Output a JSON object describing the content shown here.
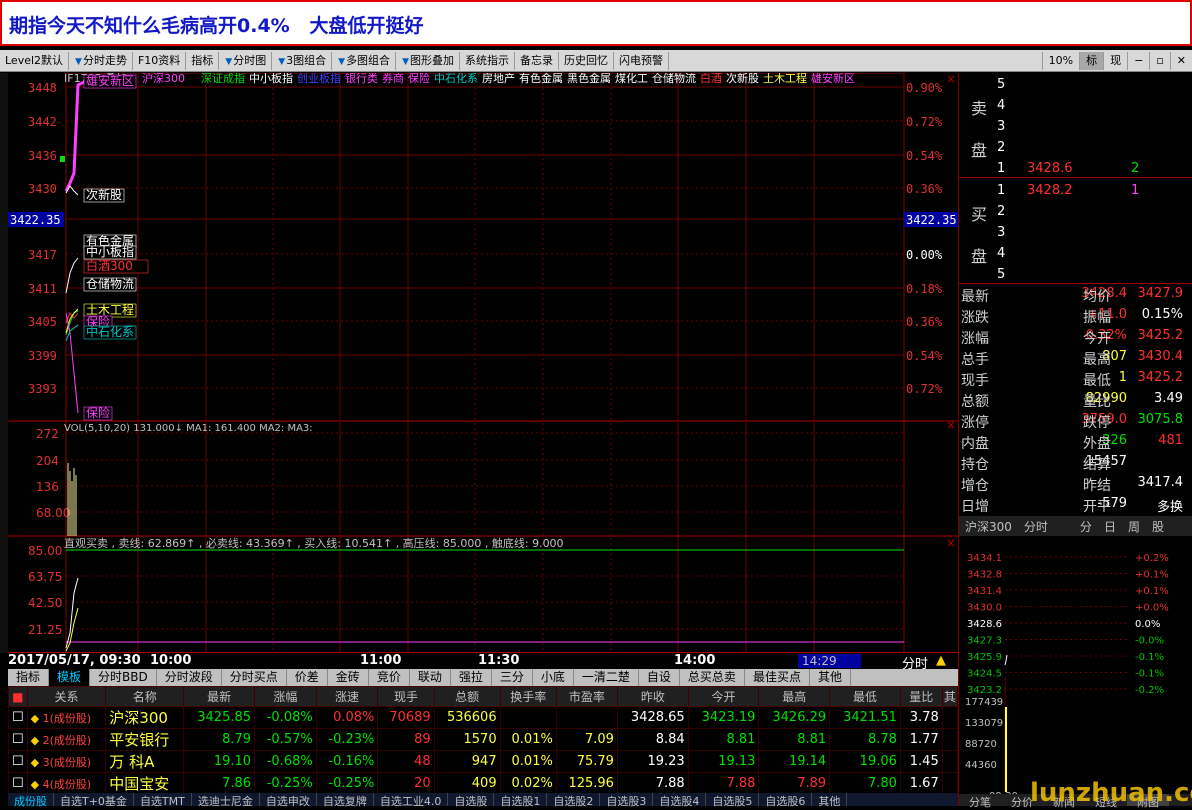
{
  "banner": {
    "text": "期指今天不知什么毛病高开0.4%   大盘低开挺好"
  },
  "toolbar": {
    "items": [
      "Level2默认",
      "分时走势",
      "F10资料",
      "指标",
      "分时图",
      "3图组合",
      "多图组合",
      "图形叠加",
      "系统指示",
      "备忘录",
      "历史回忆",
      "闪电预警"
    ],
    "right": [
      "10%",
      "标",
      "现"
    ]
  },
  "chart": {
    "code": "IF1705 叠加",
    "overlays": [
      "沪深300",
      "深证成指",
      "中小板指",
      "创业板指",
      "银行类",
      "券商",
      "保险",
      "中石化系",
      "房地产",
      "有色金属",
      "黑色金属",
      "煤化工",
      "仓储物流",
      "白酒",
      "次新股",
      "土木工程",
      "雄安新区"
    ],
    "overlay_colors": [
      "#ff40ff",
      "#00e000",
      "#ffffff",
      "#4040ff",
      "#ff40ff",
      "#ff40ff",
      "#ff40ff",
      "#00c8c8",
      "#ffffff",
      "#ffffff",
      "#ffffff",
      "#ffffff",
      "#ffffff",
      "#ff3030",
      "#ffffff",
      "#ffff40",
      "#ff40ff"
    ],
    "price_ticks": [
      "3448",
      "3442",
      "3436",
      "3430",
      "3422.35",
      "3417",
      "3411",
      "3405",
      "3399",
      "3393"
    ],
    "pct_ticks": [
      "0.90%",
      "0.72%",
      "0.54%",
      "0.36%",
      "3422.35",
      "0.00%",
      "0.18%",
      "0.36%",
      "0.54%",
      "0.72%"
    ],
    "inline_labels": [
      "雄安新区",
      "次新股",
      "有色金属",
      "中小板指",
      "白酒300",
      "仓储物流",
      "土木工程",
      "保险",
      "中石化系",
      "保险"
    ],
    "vol_header": [
      "VOL(5,10,20)",
      "131.000↓",
      "MA1: 161.400",
      "MA2:",
      "MA3:"
    ],
    "vol_ticks": [
      "272",
      "204",
      "136",
      "68.00"
    ],
    "ind_header": [
      "直观买卖",
      "卖线: 62.869↑",
      "必卖线: 43.369↑",
      "买入线: 10.541↑",
      "高压线: 85.000",
      "触底线: 9.000"
    ],
    "ind_ticks": [
      "85.00",
      "63.75",
      "42.50",
      "21.25"
    ],
    "time_axis": [
      "2017/05/17, 09:30",
      "10:00",
      "11:00",
      "11:30",
      "14:00"
    ],
    "cursor_time": "14:29",
    "mode": "分时"
  },
  "side": {
    "sell_rows": [
      {
        "n": "5",
        "p": "",
        "q": ""
      },
      {
        "n": "4",
        "p": "",
        "q": ""
      },
      {
        "n": "3",
        "p": "",
        "q": ""
      },
      {
        "n": "2",
        "p": "",
        "q": ""
      },
      {
        "n": "1",
        "p": "3428.6",
        "q": "2"
      }
    ],
    "buy_rows": [
      {
        "n": "1",
        "p": "3428.2",
        "q": "1"
      },
      {
        "n": "2",
        "p": "",
        "q": ""
      },
      {
        "n": "3",
        "p": "",
        "q": ""
      },
      {
        "n": "4",
        "p": "",
        "q": ""
      },
      {
        "n": "5",
        "p": "",
        "q": ""
      }
    ],
    "sell_label": [
      "卖",
      "盘"
    ],
    "buy_label": [
      "买",
      "盘"
    ],
    "stats": [
      {
        "l": "最新",
        "v": "3428.4",
        "vc": "red",
        "l2": "均价",
        "v2": "3427.9",
        "v2c": "red"
      },
      {
        "l": "涨跌",
        "v": "+11.0",
        "vc": "red",
        "l2": "振幅",
        "v2": "0.15%",
        "v2c": "wht"
      },
      {
        "l": "涨幅",
        "v": "0.32%",
        "vc": "red",
        "l2": "今开",
        "v2": "3425.2",
        "v2c": "red"
      },
      {
        "l": "总手",
        "v": "807",
        "vc": "yel",
        "l2": "最高",
        "v2": "3430.4",
        "v2c": "red"
      },
      {
        "l": "现手",
        "v": "1",
        "vc": "yel",
        "l2": "最低",
        "v2": "3425.2",
        "v2c": "red"
      },
      {
        "l": "总额",
        "v": "82990",
        "vc": "yel",
        "l2": "量比",
        "v2": "3.49",
        "v2c": "wht"
      },
      {
        "l": "涨停",
        "v": "3759.0",
        "vc": "red",
        "l2": "跌停",
        "v2": "3075.8",
        "v2c": "grn"
      },
      {
        "l": "内盘",
        "v": "326",
        "vc": "grn",
        "l2": "外盘",
        "v2": "481",
        "v2c": "red"
      },
      {
        "l": "持仓",
        "v": "15457",
        "vc": "wht",
        "l2": "结算",
        "v2": "",
        "v2c": "wht"
      },
      {
        "l": "增仓",
        "v": "",
        "vc": "wht",
        "l2": "昨结",
        "v2": "3417.4",
        "v2c": "wht"
      },
      {
        "l": "日增",
        "v": "-579",
        "vc": "wht",
        "l2": "开平",
        "v2": "多换",
        "v2c": "wht"
      }
    ],
    "mini_tabs": [
      "沪深300",
      "分时",
      "分",
      "日",
      "周",
      "股"
    ],
    "mini_ticks_l": [
      "3434.1",
      "3432.8",
      "3431.4",
      "3430.0",
      "3428.6",
      "3427.3",
      "3425.9",
      "3424.5",
      "3423.2"
    ],
    "mini_ticks_r": [
      "+0.2%",
      "+0.1%",
      "+0.1%",
      "+0.0%",
      "0.0%",
      "-0.0%",
      "-0.1%",
      "-0.1%",
      "-0.2%"
    ],
    "mini_vol": [
      "177439",
      "133079",
      "88720",
      "44360"
    ],
    "mini_time": "09:30",
    "bottom_tabs": [
      "分笔",
      "分价",
      "新闻",
      "短线",
      "附图"
    ]
  },
  "tabs": [
    "指标",
    "模板",
    "分时BBD",
    "分时波段",
    "分时买点",
    "价差",
    "金砖",
    "竞价",
    "联动",
    "强拉",
    "三分",
    "小底",
    "一清二楚",
    "自设",
    "总买总卖",
    "最佳买点",
    "其他"
  ],
  "table": {
    "headers": [
      "关系",
      "名称",
      "最新",
      "涨幅",
      "涨速",
      "现手",
      "总额",
      "换手率",
      "市盈率",
      "昨收",
      "今开",
      "最高",
      "最低",
      "量比",
      "其"
    ],
    "rows": [
      {
        "rel": "1(成份股)",
        "name": "沪深300",
        "last": "3425.85",
        "chg": "-0.08%",
        "spd": "0.08%",
        "vol": "70689",
        "amt": "536606",
        "turn": "",
        "pe": "",
        "prev": "3428.65",
        "open": "3423.19",
        "high": "3426.29",
        "low": "3421.51",
        "ratio": "3.78"
      },
      {
        "rel": "2(成份股)",
        "name": "平安银行",
        "last": "8.79",
        "chg": "-0.57%",
        "spd": "-0.23%",
        "vol": "89",
        "amt": "1570",
        "turn": "0.01%",
        "pe": "7.09",
        "prev": "8.84",
        "open": "8.81",
        "high": "8.81",
        "low": "8.78",
        "ratio": "1.77"
      },
      {
        "rel": "3(成份股)",
        "name": "万 科A",
        "last": "19.10",
        "chg": "-0.68%",
        "spd": "-0.16%",
        "vol": "48",
        "amt": "947",
        "turn": "0.01%",
        "pe": "75.79",
        "prev": "19.23",
        "open": "19.13",
        "high": "19.14",
        "low": "19.06",
        "ratio": "1.45"
      },
      {
        "rel": "4(成份股)",
        "name": "中国宝安",
        "last": "7.86",
        "chg": "-0.25%",
        "spd": "-0.25%",
        "vol": "20",
        "amt": "409",
        "turn": "0.02%",
        "pe": "125.96",
        "prev": "7.88",
        "open": "7.88",
        "high": "7.89",
        "low": "7.80",
        "ratio": "1.67"
      }
    ]
  },
  "bottom_tabs": [
    "成份股",
    "自选T+0基金",
    "自选TMT",
    "选迪士尼金",
    "自选申改",
    "自选复牌",
    "自选工业4.0",
    "自选股",
    "自选股1",
    "自选股2",
    "自选股3",
    "自选股4",
    "自选股5",
    "自选股6",
    "其他"
  ],
  "watermark": "lunzhuan.com"
}
